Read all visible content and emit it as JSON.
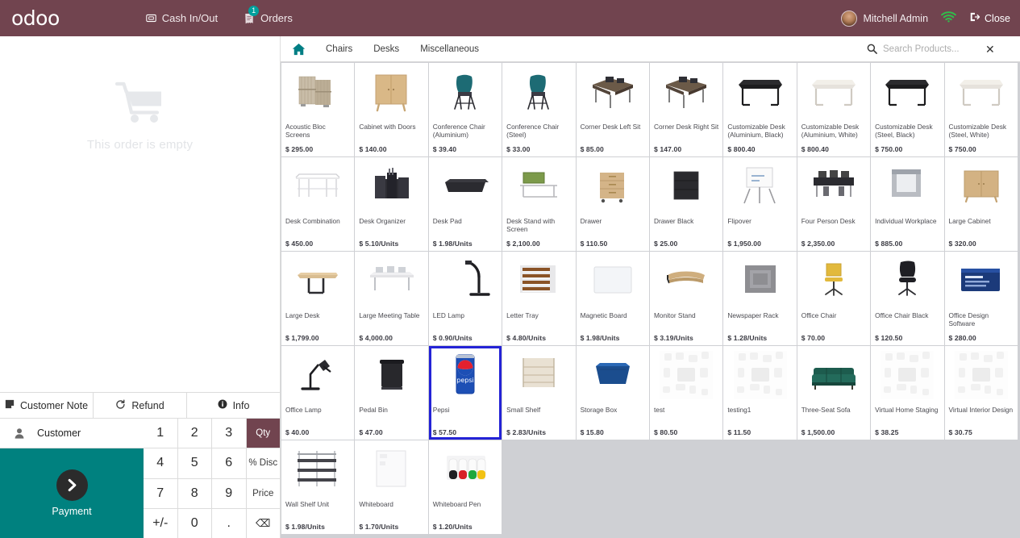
{
  "topbar": {
    "logo": "odoo",
    "cash_in_out": "Cash In/Out",
    "orders": "Orders",
    "orders_badge": "1",
    "user": "Mitchell Admin",
    "close": "Close"
  },
  "order_panel": {
    "empty_text": "This order is empty",
    "customer_note": "Customer Note",
    "refund": "Refund",
    "info": "Info",
    "customer": "Customer",
    "payment": "Payment"
  },
  "keypad": {
    "keys": [
      "1",
      "2",
      "3",
      "Qty",
      "4",
      "5",
      "6",
      "% Disc",
      "7",
      "8",
      "9",
      "Price",
      "+/-",
      "0",
      ".",
      "⌫"
    ],
    "active_mode": "Qty"
  },
  "productbar": {
    "categories": [
      "Chairs",
      "Desks",
      "Miscellaneous"
    ],
    "search_placeholder": "Search Products..."
  },
  "selected_product": "Pepsi",
  "products": [
    {
      "name": "Acoustic Bloc Screens",
      "price": "$ 295.00",
      "img": "screen"
    },
    {
      "name": "Cabinet with Doors",
      "price": "$ 140.00",
      "img": "cabinet"
    },
    {
      "name": "Conference Chair (Aluminium)",
      "price": "$ 39.40",
      "img": "chair-teal"
    },
    {
      "name": "Conference Chair (Steel)",
      "price": "$ 33.00",
      "img": "chair-teal"
    },
    {
      "name": "Corner Desk Left Sit",
      "price": "$ 85.00",
      "img": "corner-desk"
    },
    {
      "name": "Corner Desk Right Sit",
      "price": "$ 147.00",
      "img": "corner-desk"
    },
    {
      "name": "Customizable Desk (Aluminium, Black)",
      "price": "$ 800.40",
      "img": "desk-black"
    },
    {
      "name": "Customizable Desk (Aluminium, White)",
      "price": "$ 800.40",
      "img": "desk-white"
    },
    {
      "name": "Customizable Desk (Steel, Black)",
      "price": "$ 750.00",
      "img": "desk-black"
    },
    {
      "name": "Customizable Desk (Steel, White)",
      "price": "$ 750.00",
      "img": "desk-white"
    },
    {
      "name": "Desk Combination",
      "price": "$ 450.00",
      "img": "desk-combo"
    },
    {
      "name": "Desk Organizer",
      "price": "$ 5.10/Units",
      "img": "organizer"
    },
    {
      "name": "Desk Pad",
      "price": "$ 1.98/Units",
      "img": "deskpad"
    },
    {
      "name": "Desk Stand with Screen",
      "price": "$ 2,100.00",
      "img": "deskstand"
    },
    {
      "name": "Drawer",
      "price": "$ 110.50",
      "img": "drawer"
    },
    {
      "name": "Drawer Black",
      "price": "$ 25.00",
      "img": "drawer-black"
    },
    {
      "name": "Flipover",
      "price": "$ 1,950.00",
      "img": "flipover"
    },
    {
      "name": "Four Person Desk",
      "price": "$ 2,350.00",
      "img": "fourperson"
    },
    {
      "name": "Individual Workplace",
      "price": "$ 885.00",
      "img": "workplace"
    },
    {
      "name": "Large Cabinet",
      "price": "$ 320.00",
      "img": "largecabinet"
    },
    {
      "name": "Large Desk",
      "price": "$ 1,799.00",
      "img": "largedesk"
    },
    {
      "name": "Large Meeting Table",
      "price": "$ 4,000.00",
      "img": "meetingtable"
    },
    {
      "name": "LED Lamp",
      "price": "$ 0.90/Units",
      "img": "ledlamp"
    },
    {
      "name": "Letter Tray",
      "price": "$ 4.80/Units",
      "img": "lettertray"
    },
    {
      "name": "Magnetic Board",
      "price": "$ 1.98/Units",
      "img": "magboard"
    },
    {
      "name": "Monitor Stand",
      "price": "$ 3.19/Units",
      "img": "monitorstand"
    },
    {
      "name": "Newspaper Rack",
      "price": "$ 1.28/Units",
      "img": "newsrack"
    },
    {
      "name": "Office Chair",
      "price": "$ 70.00",
      "img": "officechair"
    },
    {
      "name": "Office Chair Black",
      "price": "$ 120.50",
      "img": "officechair-black"
    },
    {
      "name": "Office Design Software",
      "price": "$ 280.00",
      "img": "software"
    },
    {
      "name": "Office Lamp",
      "price": "$ 40.00",
      "img": "officelamp"
    },
    {
      "name": "Pedal Bin",
      "price": "$ 47.00",
      "img": "pedalbin"
    },
    {
      "name": "Pepsi",
      "price": "$ 57.50",
      "img": "pepsi"
    },
    {
      "name": "Small Shelf",
      "price": "$ 2.83/Units",
      "img": "smallshelf"
    },
    {
      "name": "Storage Box",
      "price": "$ 15.80",
      "img": "storagebox"
    },
    {
      "name": "test",
      "price": "$ 80.50",
      "img": "placeholder"
    },
    {
      "name": "testing1",
      "price": "$ 11.50",
      "img": "placeholder"
    },
    {
      "name": "Three-Seat Sofa",
      "price": "$ 1,500.00",
      "img": "sofa"
    },
    {
      "name": "Virtual Home Staging",
      "price": "$ 38.25",
      "img": "placeholder"
    },
    {
      "name": "Virtual Interior Design",
      "price": "$ 30.75",
      "img": "placeholder"
    },
    {
      "name": "Wall Shelf Unit",
      "price": "$ 1.98/Units",
      "img": "wallshelf"
    },
    {
      "name": "Whiteboard",
      "price": "$ 1.70/Units",
      "img": "whiteboard"
    },
    {
      "name": "Whiteboard Pen",
      "price": "$ 1.20/Units",
      "img": "wbpen"
    }
  ],
  "colors": {
    "topbar": "#71444f",
    "payment": "#00817f",
    "accent_teal": "#017e84",
    "selection": "#2423d6"
  }
}
